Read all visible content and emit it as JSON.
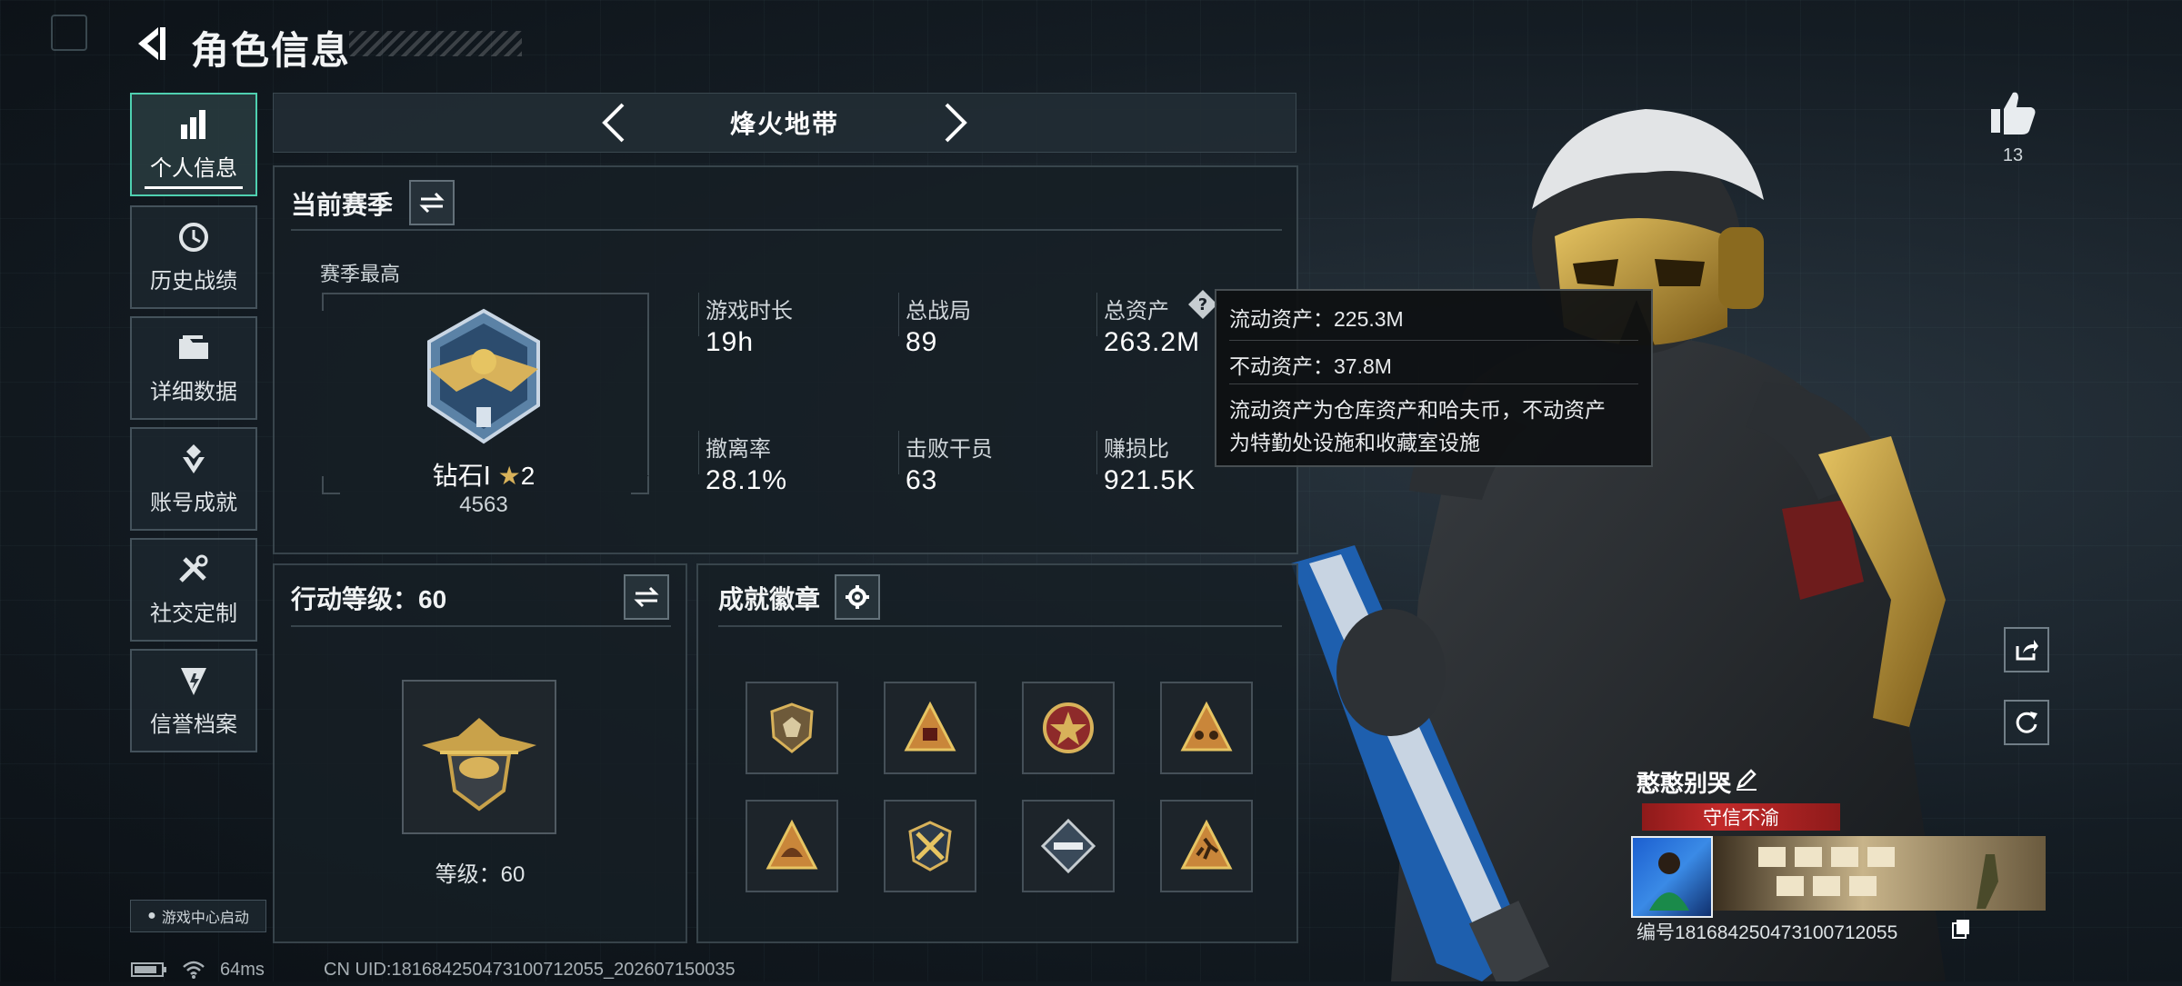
{
  "header": {
    "title": "角色信息"
  },
  "sidebar": {
    "items": [
      {
        "label": "个人信息",
        "icon": "bar-chart-icon",
        "active": true
      },
      {
        "label": "历史战绩",
        "icon": "history-icon",
        "active": false
      },
      {
        "label": "详细数据",
        "icon": "folder-icon",
        "active": false
      },
      {
        "label": "账号成就",
        "icon": "achievement-icon",
        "active": false
      },
      {
        "label": "社交定制",
        "icon": "tools-icon",
        "active": false
      },
      {
        "label": "信誉档案",
        "icon": "reputation-icon",
        "active": false
      }
    ],
    "game_center": "游戏中心启动"
  },
  "mode_selector": {
    "current": "烽火地带"
  },
  "season": {
    "title": "当前赛季",
    "best_label": "赛季最高",
    "rank_name": "钻石Ⅰ",
    "rank_stars": "2",
    "rank_points": "4563",
    "stats": [
      {
        "label": "游戏时长",
        "value": "19h"
      },
      {
        "label": "总战局",
        "value": "89"
      },
      {
        "label": "总资产",
        "value": "263.2M"
      },
      {
        "label": "撤离率",
        "value": "28.1%"
      },
      {
        "label": "击败干员",
        "value": "63"
      },
      {
        "label": "赚损比",
        "value": "921.5K"
      }
    ]
  },
  "tooltip": {
    "liquid": "流动资产：225.3M",
    "fixed": "不动资产：37.8M",
    "desc_line1": "流动资产为仓库资产和哈夫币，不动资产",
    "desc_line2": "为特勤处设施和收藏室设施"
  },
  "action_level": {
    "title": "行动等级：60",
    "level_text": "等级：60"
  },
  "achievements": {
    "title": "成就徽章",
    "badges": [
      "shield-badge",
      "triangle-badge",
      "star-medal-badge",
      "team-triangle-badge",
      "helmet-triangle-badge",
      "crossed-weapons-badge",
      "missile-diamond-badge",
      "runner-triangle-badge"
    ]
  },
  "profile": {
    "likes": "13",
    "player_name": "憨憨别哭",
    "title_badge": "守信不渝",
    "player_id": "编号1816842504731007120​55"
  },
  "footer": {
    "ping": "64ms",
    "uid": "CN UID:1816842504731007120​55_202607150035"
  },
  "colors": {
    "accent": "#4fd0b0",
    "title_badge": "#c22a2a",
    "gold": "#c9a24a"
  }
}
